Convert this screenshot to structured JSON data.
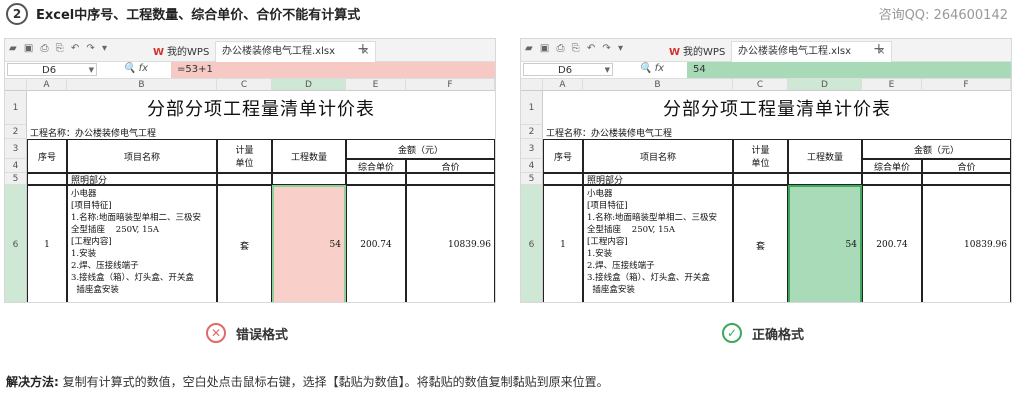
{
  "header": {
    "step_number": "2",
    "title": "Excel中序号、工程数量、综合单价、合价不能有计算式",
    "qq": "咨询QQ: 264600142"
  },
  "toolbar": {
    "tab_wps": "我的WPS",
    "tab_file": "办公楼装修电气工程.xlsx",
    "close_glyph": "×",
    "plus_glyph": "+"
  },
  "columns": [
    "A",
    "B",
    "C",
    "D",
    "E",
    "F"
  ],
  "rows": [
    "1",
    "2",
    "3",
    "4",
    "5",
    "6"
  ],
  "sheet": {
    "title": "分部分项工程量清单计价表",
    "project": "工程名称：办公楼装修电气工程",
    "h_seq": "序号",
    "h_name": "项目名称",
    "h_unit": "计量\n单位",
    "h_qty": "工程数量",
    "h_amount": "金额（元）",
    "h_unit_price": "综合单价",
    "h_total": "合价",
    "section": "照明部分",
    "item_seq": "1",
    "item_desc": "小电器\n[项目特征]\n1.名称:地面暗装型单相二、三极安\n全型插座    250V, 15A\n[工程内容]\n1.安装\n2.焊、压接线端子\n3.接线盒（箱）、灯头盒、开关盒\n  插座盒安装",
    "item_unit": "套",
    "item_qty": "54",
    "item_price": "200.74",
    "item_total": "10839.96"
  },
  "wrong": {
    "namebox": "D6",
    "formula": "=53+1",
    "label": "错误格式",
    "icon_glyph": "✕",
    "accent": "#e06a6a"
  },
  "right": {
    "namebox": "D6",
    "formula": "54",
    "label": "正确格式",
    "icon_glyph": "✓",
    "accent": "#3ea85a"
  },
  "solution": {
    "label": "解决方法:",
    "text": "复制有计算式的数值，空白处点击鼠标右键，选择【黏贴为数值】。将黏贴的数值复制黏贴到原来位置。"
  }
}
